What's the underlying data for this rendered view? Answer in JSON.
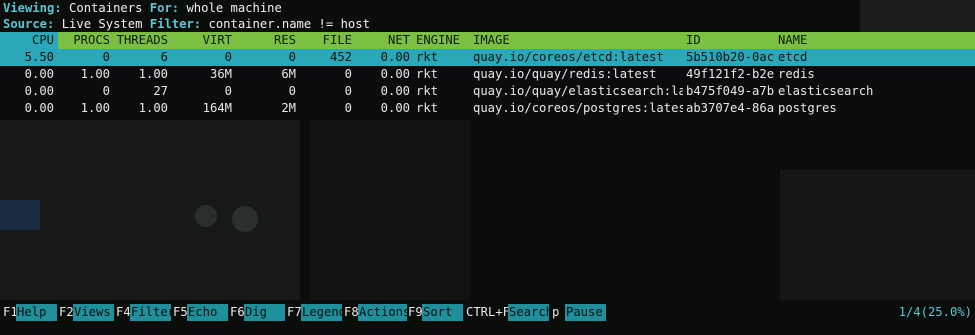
{
  "info": {
    "viewing_label": "Viewing:",
    "viewing_value": "Containers",
    "for_label": "For:",
    "for_value": "whole machine",
    "source_label": "Source:",
    "source_value": "Live System",
    "filter_label": "Filter:",
    "filter_value": "container.name != host"
  },
  "columns": {
    "cpu": "CPU",
    "procs": "PROCS",
    "threads": "THREADS",
    "virt": "VIRT",
    "res": "RES",
    "file": "FILE",
    "net": "NET",
    "engine": "ENGINE",
    "image": "IMAGE",
    "id": "ID",
    "name": "NAME"
  },
  "rows": [
    {
      "cpu": "5.50",
      "procs": "0",
      "threads": "6",
      "virt": "0",
      "res": "0",
      "file": "452",
      "net": "0.00",
      "engine": "rkt",
      "image": "quay.io/coreos/etcd:latest",
      "id": "5b510b20-0ac",
      "name": "etcd"
    },
    {
      "cpu": "0.00",
      "procs": "1.00",
      "threads": "1.00",
      "virt": "36M",
      "res": "6M",
      "file": "0",
      "net": "0.00",
      "engine": "rkt",
      "image": "quay.io/quay/redis:latest",
      "id": "49f121f2-b2e",
      "name": "redis"
    },
    {
      "cpu": "0.00",
      "procs": "0",
      "threads": "27",
      "virt": "0",
      "res": "0",
      "file": "0",
      "net": "0.00",
      "engine": "rkt",
      "image": "quay.io/quay/elasticsearch:la",
      "id": "b475f049-a7b",
      "name": "elasticsearch"
    },
    {
      "cpu": "0.00",
      "procs": "1.00",
      "threads": "1.00",
      "virt": "164M",
      "res": "2M",
      "file": "0",
      "net": "0.00",
      "engine": "rkt",
      "image": "quay.io/coreos/postgres:lates",
      "id": "ab3707e4-86a",
      "name": "postgres"
    }
  ],
  "function_keys": [
    {
      "key": "F1",
      "label": "Help"
    },
    {
      "key": "F2",
      "label": "Views"
    },
    {
      "key": "F4",
      "label": "Filter"
    },
    {
      "key": "F5",
      "label": "Echo"
    },
    {
      "key": "F6",
      "label": "Dig"
    },
    {
      "key": "F7",
      "label": "Legend"
    },
    {
      "key": "F8",
      "label": "Actions"
    },
    {
      "key": "F9",
      "label": "Sort"
    },
    {
      "key": "CTRL+F",
      "label": "Search"
    },
    {
      "key": "p",
      "label": "Pause"
    }
  ],
  "status": "1/4(25.0%)",
  "colors": {
    "header_green": "#7bc043",
    "selection_cyan": "#2aa7b8",
    "label_cyan": "#56c7d6"
  }
}
